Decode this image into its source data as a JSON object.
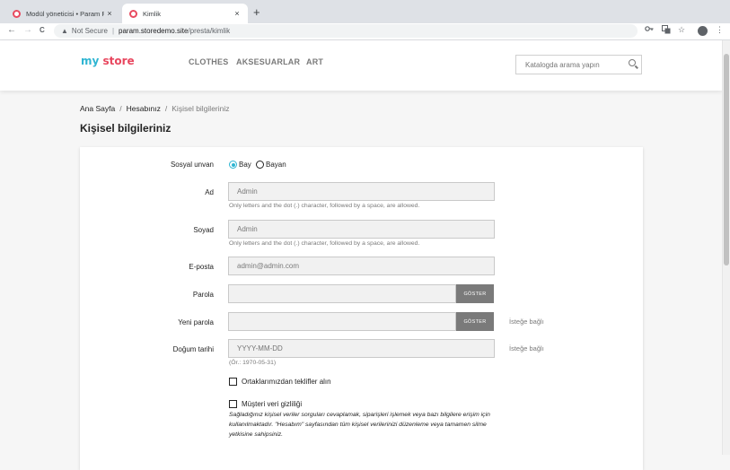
{
  "browser": {
    "tabs": [
      {
        "title": "Modül yöneticisi • Param POS",
        "close": "×"
      },
      {
        "title": "Kimlik",
        "close": "×"
      }
    ],
    "new_tab": "+",
    "nav": {
      "back": "←",
      "forward": "→",
      "reload": "C"
    },
    "address": {
      "security": "Not Secure",
      "host": "param.storedemo.site",
      "path": "/presta/kimlik"
    },
    "icons": {
      "key": "key-icon",
      "translate": "translate-icon",
      "star": "star-icon",
      "menu": "⋮"
    }
  },
  "header": {
    "logo": {
      "part1": "my",
      "part2": "store"
    },
    "menu": [
      "CLOTHES",
      "AKSESUARLAR",
      "ART"
    ],
    "search_placeholder": "Katalogda arama yapın"
  },
  "breadcrumb": {
    "items": [
      "Ana Sayfa",
      "Hesabınız",
      "Kişisel bilgileriniz"
    ],
    "separator": "/"
  },
  "page_title": "Kişisel bilgileriniz",
  "form": {
    "social_title": {
      "label": "Sosyal unvan",
      "options": [
        "Bay",
        "Bayan"
      ],
      "selected": "Bay"
    },
    "first_name": {
      "label": "Ad",
      "value": "Admin",
      "hint": "Only letters and the dot (.) character, followed by a space, are allowed."
    },
    "last_name": {
      "label": "Soyad",
      "value": "Admin",
      "hint": "Only letters and the dot (.) character, followed by a space, are allowed."
    },
    "email": {
      "label": "E-posta",
      "value": "admin@admin.com"
    },
    "password": {
      "label": "Parola",
      "value": "",
      "show_button": "GÖSTER"
    },
    "new_password": {
      "label": "Yeni parola",
      "value": "",
      "show_button": "GÖSTER",
      "optional": "İsteğe bağlı"
    },
    "birthday": {
      "label": "Doğum tarihi",
      "placeholder": "YYYY-MM-DD",
      "hint": "(Ör.: 1970-05-31)",
      "optional": "İsteğe bağlı"
    },
    "partner_offers": {
      "label": "Ortaklarımızdan teklifler alın",
      "checked": false
    },
    "customer_privacy": {
      "label": "Müşteri veri gizliliği",
      "checked": false,
      "description": "Sağladığınız kişisel veriler sorguları cevaplamak, siparişleri işlemek veya bazı bilgilere erişim için kullanılmaktadır. \"Hesabım\" sayfasından tüm kişisel verilerinizi düzenleme veya tamamen silme yetkisine sahipsiniz."
    }
  },
  "colors": {
    "accent": "#2fb5d2",
    "logo_red": "#e8465e",
    "button_gray": "#7a7a7a"
  }
}
